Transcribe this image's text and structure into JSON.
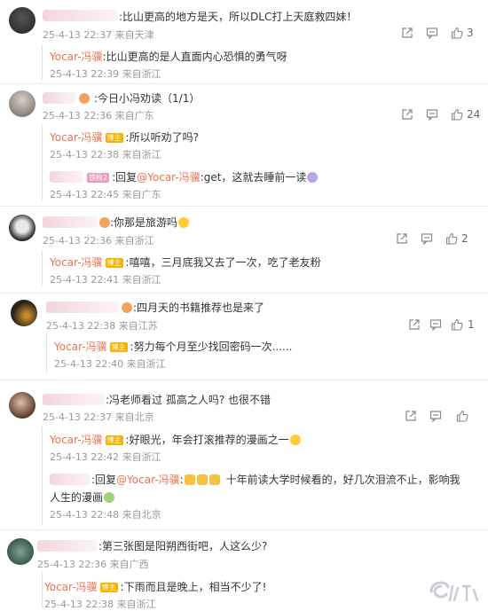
{
  "actions_labels": {
    "share": "share-icon",
    "comment": "comment-icon",
    "like": "like-icon"
  },
  "comments": [
    {
      "text": ":比山更高的地方是天，所以DLC打上天庭救四妹！",
      "meta": "25-4-13 22:37 来自天津",
      "likes": "3",
      "replies": [
        {
          "name": "Yocar-冯骥",
          "badge": "",
          "text": ":比山更高的是人直面内心恐惧的勇气呀",
          "meta": "25-4-13 22:39 来自浙江"
        }
      ]
    },
    {
      "text": ":今日小冯劝读（1/1）",
      "meta": "25-4-13 22:36 来自广东",
      "likes": "24",
      "replies": [
        {
          "name": "Yocar-冯骥",
          "badge": "博主",
          "text": ":所以听劝了吗?",
          "meta": "25-4-13 22:38 来自浙江"
        },
        {
          "name": "",
          "badge": "铁粉2",
          "text": ":回复",
          "mention": "@Yocar-冯骥",
          "text2": ":get，这就去睡前一读",
          "meta": "25-4-13 22:45 来自广东"
        }
      ]
    },
    {
      "text": ":你那是旅游吗",
      "meta": "25-4-13 22:36 来自浙江",
      "likes": "2",
      "replies": [
        {
          "name": "Yocar-冯骥",
          "badge": "博主",
          "text": ":嘻嘻，三月底我又去了一次，吃了老友粉",
          "meta": "25-4-13 22:41 来自浙江"
        }
      ]
    },
    {
      "text": ":四月天的书籍推荐也是来了",
      "meta": "25-4-13 22:38 来自江苏",
      "likes": "1",
      "replies": [
        {
          "name": "Yocar-冯骥",
          "badge": "博主",
          "text": ":努力每个月至少找回密码一次......",
          "meta": "25-4-13 22:40 来自浙江"
        }
      ]
    },
    {
      "text": ":冯老师看过 孤高之人吗? 也很不错",
      "meta": "25-4-13 22:37 来自北京",
      "likes": "",
      "replies": [
        {
          "name": "Yocar-冯骥",
          "badge": "博主",
          "text": ":好眼光，年会打滚推荐的漫画之一",
          "meta": "25-4-13 22:42 来自浙江"
        },
        {
          "name": "",
          "badge": "",
          "text": ":回复",
          "mention": "@Yocar-冯骥",
          "text2": ":",
          "text3": "十年前读大学时候看的，好几次泪流不止，影响我",
          "text4": "人生的漫画",
          "meta": "25-4-13 22:48 来自北京"
        }
      ]
    },
    {
      "text": ":第三张图是阳朔西街吧，人这么少?",
      "meta": "25-4-13 22:36 来自广西",
      "likes": "",
      "replies": [
        {
          "name": "Yocar-冯骥",
          "badge": "博主",
          "text": ":下雨而且是晚上，相当不少了!",
          "meta": "25-4-13 22:38 来自浙江"
        }
      ]
    }
  ]
}
